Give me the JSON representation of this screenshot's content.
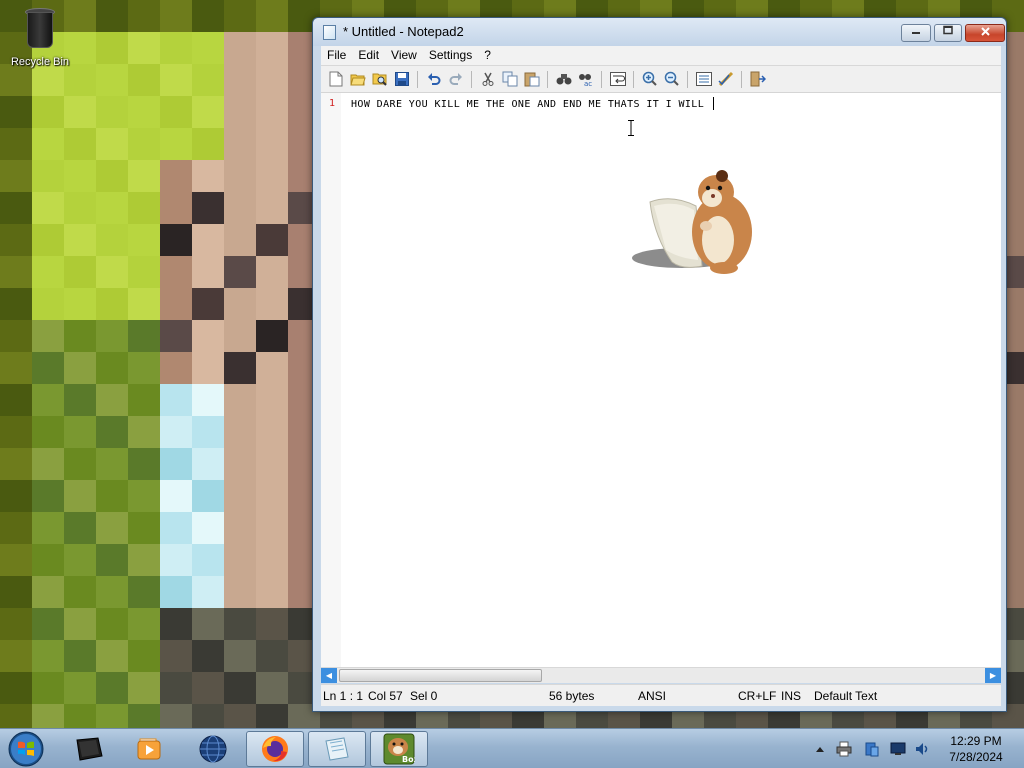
{
  "desktop": {
    "icons": [
      {
        "label": "Recycle Bin",
        "icon": "recycle-bin-icon"
      }
    ]
  },
  "window": {
    "title": "* Untitled - Notepad2",
    "buttons": {
      "minimize": "minimize-icon",
      "maximize": "maximize-icon",
      "close": "close-icon"
    }
  },
  "menu": [
    "File",
    "Edit",
    "View",
    "Settings",
    "?"
  ],
  "toolbar": [
    "new-file",
    "open-file",
    "browse",
    "save",
    "undo",
    "redo",
    "cut",
    "copy",
    "paste",
    "find",
    "replace",
    "word-wrap",
    "zoom-in",
    "zoom-out",
    "view-settings",
    "scheme",
    "exit"
  ],
  "editor": {
    "line_number": "1",
    "line_text": "HOW DARE YOU KILL ME THE ONE AND END ME THATS IT I WILL "
  },
  "status": {
    "position": "Ln 1 : 1",
    "column": "Col 57",
    "selection": "Sel 0",
    "size": "56 bytes",
    "encoding": "ANSI",
    "line_ending": "CR+LF",
    "mode": "INS",
    "scheme": "Default Text"
  },
  "taskbar": {
    "pinned": [
      "start-orb-icon",
      "console-icon",
      "media-player-icon",
      "globe-icon",
      "firefox-icon",
      "notepad2-icon",
      "box-hamster-icon"
    ],
    "box_label": "Box",
    "clock": {
      "time": "12:29 PM",
      "date": "7/28/2024"
    },
    "tray": [
      "show-hidden-icons-arrow",
      "printer-icon",
      "network-share-icon",
      "monitor-icon",
      "volume-icon"
    ]
  },
  "colors": {
    "accent": "#3c8fe0",
    "line_number": "#d02020",
    "close_button": "#c7452b"
  }
}
